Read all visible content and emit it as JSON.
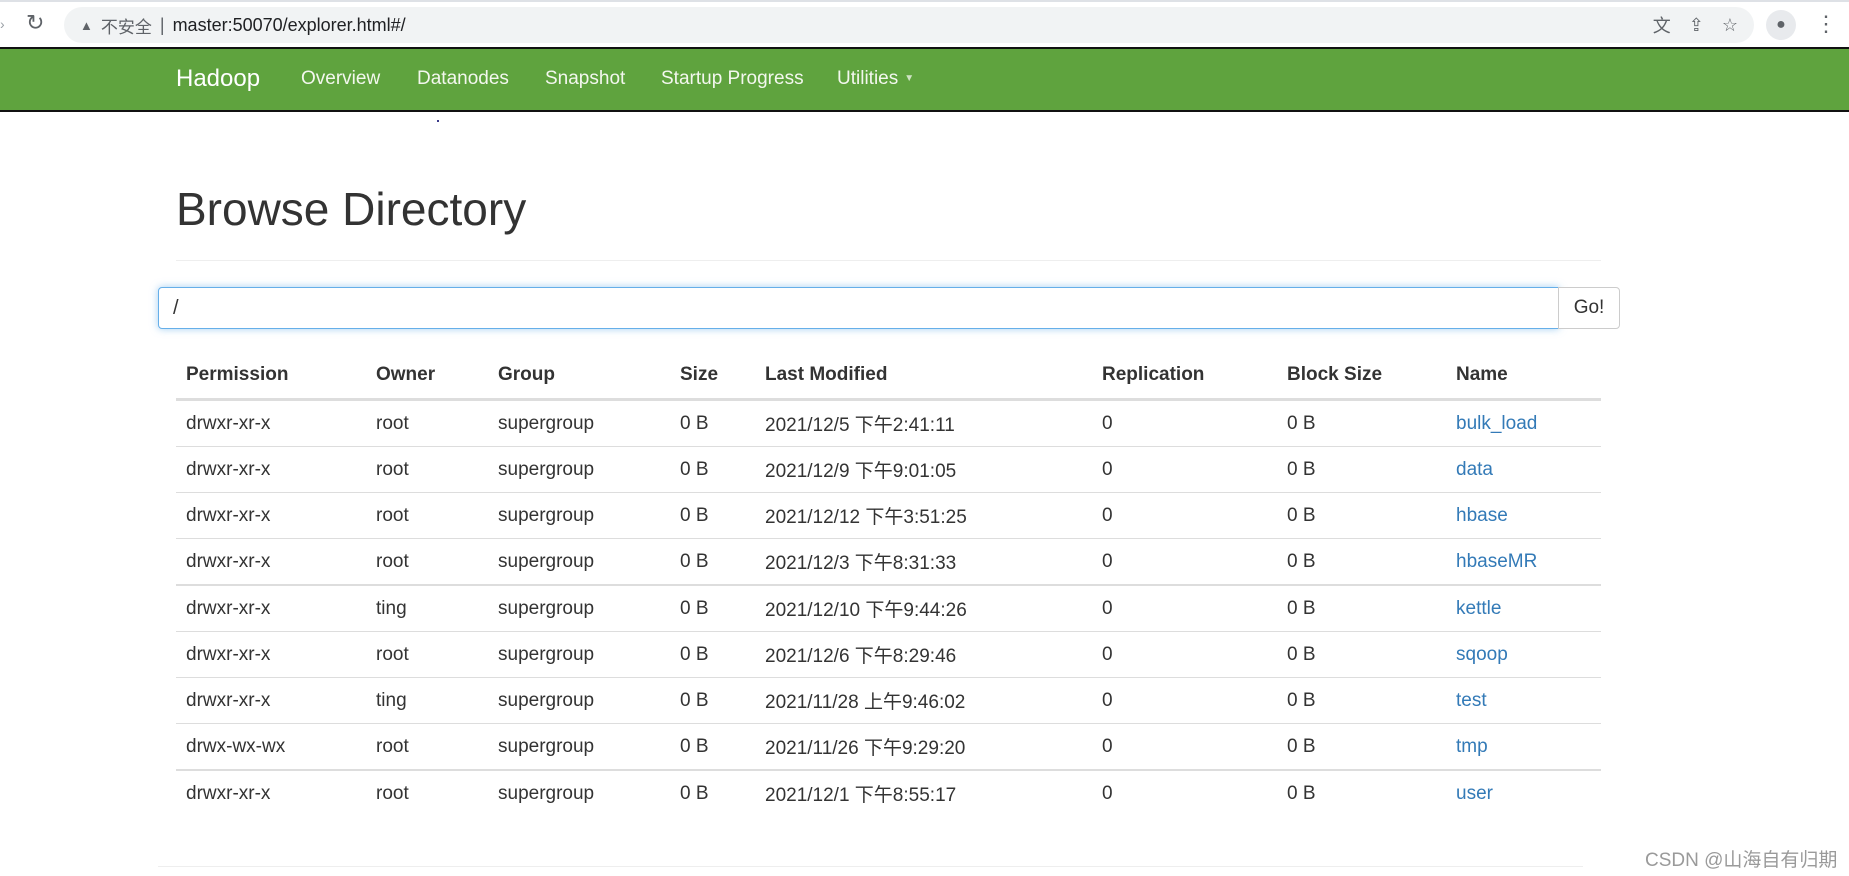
{
  "browser": {
    "security_label": "不安全",
    "url": "master:50070/explorer.html#/",
    "icons": [
      "translate-icon",
      "share-icon",
      "bookmark-star-icon"
    ],
    "reload_icon": "reload-icon",
    "profile_icon": "profile-avatar-icon",
    "menu_icon": "kebab-menu-icon"
  },
  "navbar": {
    "brand": "Hadoop",
    "items": [
      "Overview",
      "Datanodes",
      "Snapshot",
      "Startup Progress",
      "Utilities"
    ],
    "bg_color": "#5fa33e"
  },
  "page": {
    "title": "Browse Directory",
    "path_value": "/",
    "go_label": "Go!"
  },
  "table": {
    "headers": [
      "Permission",
      "Owner",
      "Group",
      "Size",
      "Last Modified",
      "Replication",
      "Block Size",
      "Name"
    ],
    "rows": [
      [
        "drwxr-xr-x",
        "root",
        "supergroup",
        "0 B",
        "2021/12/5 下午2:41:11",
        "0",
        "0 B",
        "bulk_load"
      ],
      [
        "drwxr-xr-x",
        "root",
        "supergroup",
        "0 B",
        "2021/12/9 下午9:01:05",
        "0",
        "0 B",
        "data"
      ],
      [
        "drwxr-xr-x",
        "root",
        "supergroup",
        "0 B",
        "2021/12/12 下午3:51:25",
        "0",
        "0 B",
        "hbase"
      ],
      [
        "drwxr-xr-x",
        "root",
        "supergroup",
        "0 B",
        "2021/12/3 下午8:31:33",
        "0",
        "0 B",
        "hbaseMR"
      ],
      [
        "drwxr-xr-x",
        "ting",
        "supergroup",
        "0 B",
        "2021/12/10 下午9:44:26",
        "0",
        "0 B",
        "kettle"
      ],
      [
        "drwxr-xr-x",
        "root",
        "supergroup",
        "0 B",
        "2021/12/6 下午8:29:46",
        "0",
        "0 B",
        "sqoop"
      ],
      [
        "drwxr-xr-x",
        "ting",
        "supergroup",
        "0 B",
        "2021/11/28 上午9:46:02",
        "0",
        "0 B",
        "test"
      ],
      [
        "drwx-wx-wx",
        "root",
        "supergroup",
        "0 B",
        "2021/11/26 下午9:29:20",
        "0",
        "0 B",
        "tmp"
      ],
      [
        "drwxr-xr-x",
        "root",
        "supergroup",
        "0 B",
        "2021/12/1 下午8:55:17",
        "0",
        "0 B",
        "user"
      ]
    ],
    "link_color": "#337ab7"
  },
  "watermark": "CSDN @山海自有归期"
}
